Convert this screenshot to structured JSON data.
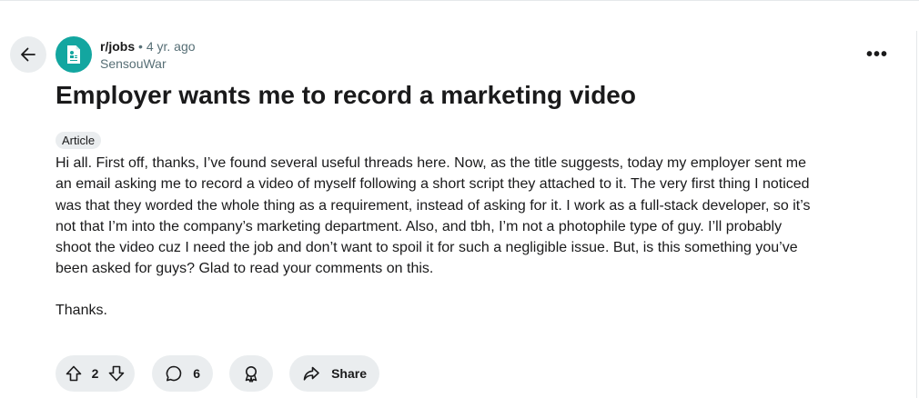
{
  "post": {
    "subreddit": "r/jobs",
    "separator": "•",
    "age": "4 yr. ago",
    "author": "SensouWar",
    "title": "Employer wants me to record a marketing video",
    "flair": "Article",
    "body_lines": [
      "Hi all. First off, thanks, I’ve found several useful threads here. Now, as the title suggests, today my employer sent me",
      "an email asking me to record a video of myself following a short script they attached to it. The very first thing I noticed",
      "was that they worded the whole thing as a requirement, instead of asking for it. I work as a full-stack developer, so it’s",
      "not that I’m into the company’s marketing department. Also, and tbh, I’m not a photophile type of guy. I’ll probably",
      "shoot the video cuz I need the job and don’t want to spoil it for such a negligible issue. But, is this something you’ve",
      "been asked for guys? Glad to read your comments on this."
    ],
    "signoff": "Thanks."
  },
  "actions": {
    "score": "2",
    "comments": "6",
    "share_label": "Share"
  },
  "overflow_label": "•••",
  "icons": {
    "back": "arrow-left-icon",
    "avatar": "subreddit-avatar-icon",
    "upvote": "upvote-arrow-icon",
    "downvote": "downvote-arrow-icon",
    "comment": "comment-bubble-icon",
    "award": "award-icon",
    "share": "share-arrow-icon"
  },
  "colors": {
    "avatar_bg": "#13a6a0",
    "pill_bg": "#eaedef",
    "muted_text": "#576f76"
  }
}
